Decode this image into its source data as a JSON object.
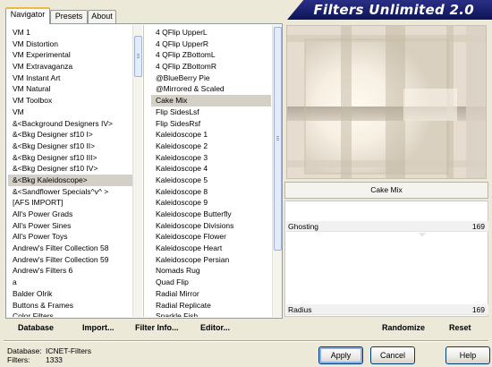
{
  "tabs": [
    "Navigator",
    "Presets",
    "About"
  ],
  "active_tab": "Navigator",
  "header_title": "Filters Unlimited 2.0",
  "categories": [
    "VM 1",
    "VM Distortion",
    "VM Experimental",
    "VM Extravaganza",
    "VM Instant Art",
    "VM Natural",
    "VM Toolbox",
    "VM",
    "&<Background Designers IV>",
    "&<Bkg Designer sf10 I>",
    "&<Bkg Designer sf10 II>",
    "&<Bkg Designer sf10 III>",
    "&<Bkg Designer sf10 IV>",
    "&<Bkg Kaleidoscope>",
    "&<Sandflower Specials^v^ >",
    "[AFS IMPORT]",
    "All's Power Grads",
    "All's Power Sines",
    "All's Power Toys",
    "Andrew's Filter Collection 58",
    "Andrew's Filter Collection 59",
    "Andrew's Filters 6",
    "a",
    "Balder Olrik",
    "Buttons & Frames",
    "Color Filters"
  ],
  "selected_category": "&<Bkg Kaleidoscope>",
  "filters": [
    "4 QFlip UpperL",
    "4 QFlip UpperR",
    "4 QFlip ZBottomL",
    "4 QFlip ZBottomR",
    "@BlueBerry Pie",
    "@Mirrored & Scaled",
    "Cake Mix",
    "Flip SidesLsf",
    "Flip SidesRsf",
    "Kaleidoscope 1",
    "Kaleidoscope 2",
    "Kaleidoscope 3",
    "Kaleidoscope 4",
    "Kaleidoscope 5",
    "Kaleidoscope 8",
    "Kaleidoscope 9",
    "Kaleidoscope Butterfly",
    "Kaleidoscope Divisions",
    "Kaleidoscope Flower",
    "Kaleidoscope Heart",
    "Kaleidoscope Persian",
    "Nomads Rug",
    "Quad Flip",
    "Radial Mirror",
    "Radial Replicate",
    "Sparkle Fish"
  ],
  "selected_filter": "Cake Mix",
  "current_filter_name": "Cake Mix",
  "params": {
    "ghosting": {
      "label": "Ghosting",
      "value": "169"
    },
    "radius": {
      "label": "Radius",
      "value": "169"
    }
  },
  "toolbar": {
    "database": "Database",
    "import": "Import...",
    "filter_info": "Filter Info...",
    "editor": "Editor...",
    "randomize": "Randomize",
    "reset": "Reset"
  },
  "footer": {
    "database_label": "Database:",
    "database_value": "ICNET-Filters",
    "filters_label": "Filters:",
    "filters_value": "1333"
  },
  "buttons": {
    "apply": "Apply",
    "cancel": "Cancel",
    "help": "Help"
  },
  "colors": {
    "banner": "#1a1f6e",
    "selection": "#d4d0c8",
    "preview_base": "#e8e0d4"
  }
}
